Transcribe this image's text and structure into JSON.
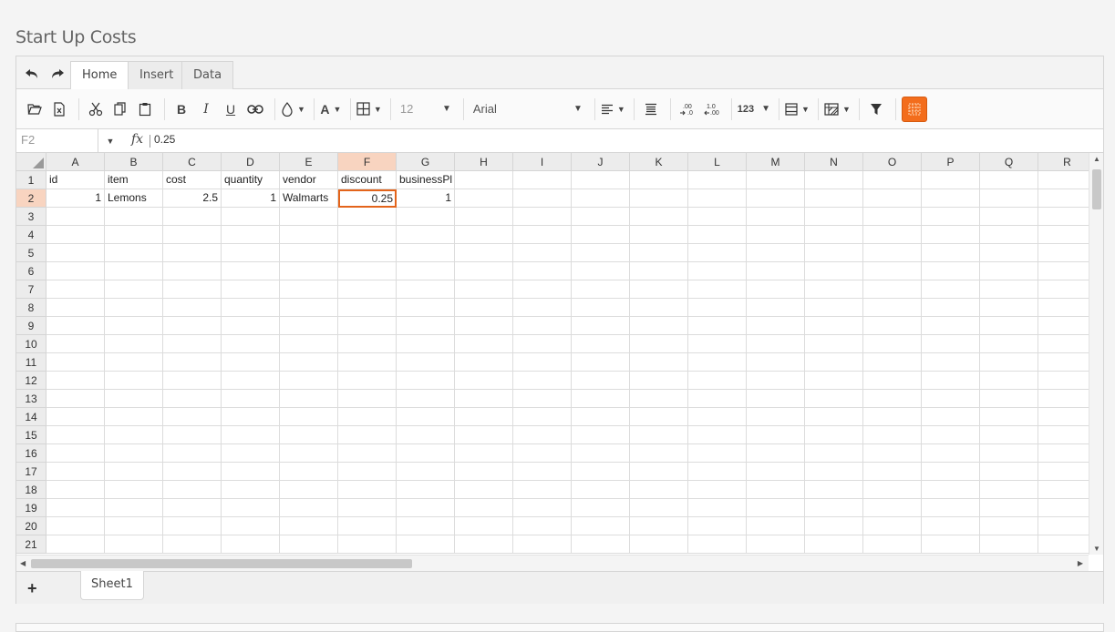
{
  "page": {
    "title": "Start Up Costs"
  },
  "tabs": [
    {
      "label": "Home",
      "active": true
    },
    {
      "label": "Insert",
      "active": false
    },
    {
      "label": "Data",
      "active": false
    }
  ],
  "toolbar": {
    "font_size": "12",
    "font_family": "Arial",
    "icons": [
      "open-icon",
      "export-icon",
      "cut-icon",
      "copy-icon",
      "paste-icon",
      "bold-icon",
      "italic-icon",
      "underline-icon",
      "hyperlink-icon",
      "background-color-icon",
      "text-color-icon",
      "borders-icon",
      "align-icon",
      "wrap-icon",
      "increase-decimal-icon",
      "decrease-decimal-icon",
      "format-icon",
      "merge-icon",
      "freeze-icon",
      "filter-icon",
      "gridlines-icon"
    ],
    "bold_label": "B",
    "italic_label": "I",
    "underline_label": "U",
    "text_color_label": "A",
    "format_label": "123",
    "inc_dec_label": ".00",
    "dec_dec_label": ".00"
  },
  "formula_bar": {
    "cell_ref": "F2",
    "fx_label": "fx",
    "value": "0.25"
  },
  "columns": [
    "A",
    "B",
    "C",
    "D",
    "E",
    "F",
    "G",
    "H",
    "I",
    "J",
    "K",
    "L",
    "M",
    "N",
    "O",
    "P",
    "Q",
    "R"
  ],
  "rows": [
    "1",
    "2",
    "3",
    "4",
    "5",
    "6",
    "7",
    "8",
    "9",
    "10",
    "11",
    "12",
    "13",
    "14",
    "15",
    "16",
    "17",
    "18",
    "19",
    "20",
    "21"
  ],
  "selected": {
    "col": "F",
    "row": "2"
  },
  "cells": {
    "r1": [
      "id",
      "item",
      "cost",
      "quantity",
      "vendor",
      "discount",
      "businessPl"
    ],
    "r2": [
      "1",
      "Lemons",
      "2.5",
      "1",
      "Walmarts",
      "0.25",
      "1"
    ]
  },
  "sheets": [
    {
      "label": "Sheet1",
      "active": true
    }
  ],
  "add_sheet_label": "+",
  "colors": {
    "accent": "#f36d1c",
    "selected_header": "#f8d4c0",
    "active_border": "#e3641b"
  }
}
